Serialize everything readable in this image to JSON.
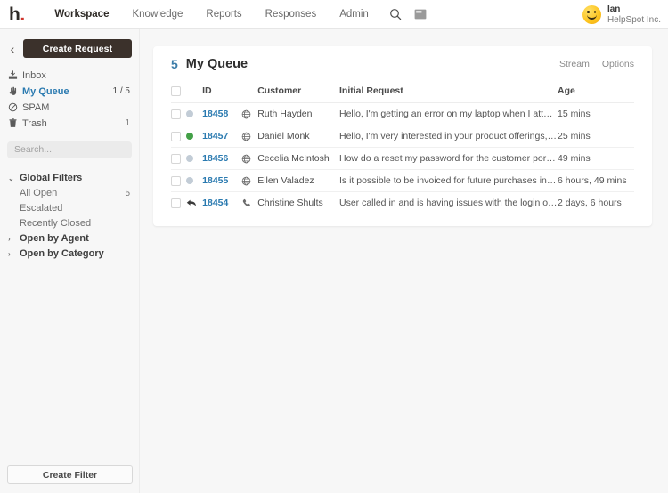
{
  "topnav": {
    "logo_text": "h",
    "logo_dot": ".",
    "links": [
      {
        "label": "Workspace",
        "active": true
      },
      {
        "label": "Knowledge",
        "active": false
      },
      {
        "label": "Reports",
        "active": false
      },
      {
        "label": "Responses",
        "active": false
      },
      {
        "label": "Admin",
        "active": false
      }
    ],
    "search_icon": "search-icon",
    "window_icon": "window-icon",
    "user": {
      "name": "Ian",
      "org": "HelpSpot Inc."
    }
  },
  "sidebar": {
    "back_label": "‹",
    "create_request_label": "Create Request",
    "items": [
      {
        "label": "Inbox",
        "count": "",
        "icon": "inbox-icon",
        "active": false
      },
      {
        "label": "My Queue",
        "count": "1 / 5",
        "icon": "queue-hand-icon",
        "active": true
      },
      {
        "label": "SPAM",
        "count": "",
        "icon": "spam-icon",
        "active": false
      },
      {
        "label": "Trash",
        "count": "1",
        "icon": "trash-icon",
        "active": false
      }
    ],
    "search_placeholder": "Search...",
    "filter_groups": [
      {
        "label": "Global Filters",
        "expanded": true,
        "caret": "⌄",
        "children": [
          {
            "label": "All Open",
            "count": "5"
          },
          {
            "label": "Escalated",
            "count": ""
          },
          {
            "label": "Recently Closed",
            "count": ""
          }
        ]
      },
      {
        "label": "Open by Agent",
        "expanded": false,
        "caret": "›",
        "children": []
      },
      {
        "label": "Open by Category",
        "expanded": false,
        "caret": "›",
        "children": []
      }
    ],
    "create_filter_label": "Create Filter"
  },
  "main": {
    "queue_count": "5",
    "queue_title": "My Queue",
    "actions": [
      {
        "label": "Stream"
      },
      {
        "label": "Options"
      }
    ],
    "columns": {
      "id": "ID",
      "customer": "Customer",
      "request": "Initial Request",
      "age": "Age"
    },
    "rows": [
      {
        "status": "gray",
        "status_icon": "status-dot",
        "id": "18458",
        "channel": "globe-icon",
        "customer": "Ruth Hayden",
        "request": "Hello, I'm getting an error on my laptop when I attempt to co...",
        "age": "15 mins"
      },
      {
        "status": "green",
        "status_icon": "status-dot",
        "id": "18457",
        "channel": "globe-icon",
        "customer": "Daniel Monk",
        "request": "Hello, I'm very interested in your product offerings, but I'm n...",
        "age": "25 mins"
      },
      {
        "status": "gray",
        "status_icon": "status-dot",
        "id": "18456",
        "channel": "globe-icon",
        "customer": "Cecelia McIntosh",
        "request": "How do a reset my password for the customer portal?",
        "age": "49 mins"
      },
      {
        "status": "gray",
        "status_icon": "status-dot",
        "id": "18455",
        "channel": "globe-icon",
        "customer": "Ellen Valadez",
        "request": "Is it possible to be invoiced for future purchases instead of h...",
        "age": "6 hours, 49 mins"
      },
      {
        "status": "reply",
        "status_icon": "reply-arrow-icon",
        "id": "18454",
        "channel": "phone-icon",
        "customer": "Christine Shults",
        "request": "User called in and is having issues with the login on their PO...",
        "age": "2 days, 6 hours"
      }
    ]
  },
  "colors": {
    "accent_blue": "#2a7ab0",
    "button_dark": "#3b312b",
    "status_green": "#43a047",
    "status_gray": "#c2ccd6",
    "logo_red": "#d0342c",
    "page_bg": "#f7f7f7"
  }
}
